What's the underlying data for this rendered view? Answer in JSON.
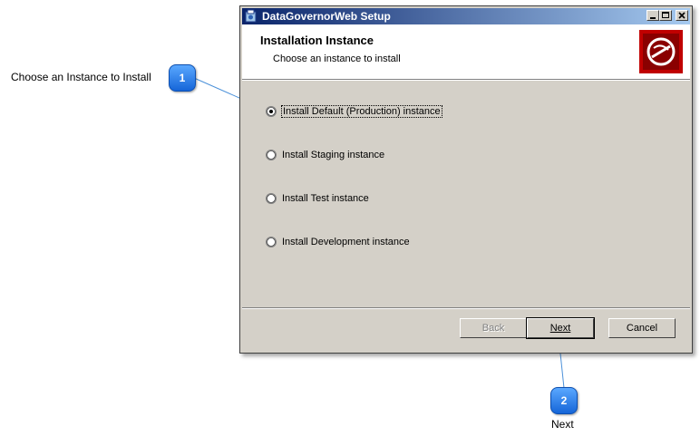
{
  "window": {
    "title": "DataGovernorWeb Setup",
    "header_title": "Installation Instance",
    "header_subtitle": "Choose an instance to install"
  },
  "options": [
    {
      "label": "Install Default (Production) instance",
      "selected": true
    },
    {
      "label": "Install Staging instance",
      "selected": false
    },
    {
      "label": "Install Test instance",
      "selected": false
    },
    {
      "label": "Install Development instance",
      "selected": false
    }
  ],
  "buttons": {
    "back": "Back",
    "next": "Next",
    "cancel": "Cancel"
  },
  "callouts": [
    {
      "number": "1",
      "label": "Choose an Instance to Install"
    },
    {
      "number": "2",
      "label": "Next"
    }
  ],
  "colors": {
    "callout_badge": "#1e7ae8",
    "logo_red": "#c00000"
  }
}
